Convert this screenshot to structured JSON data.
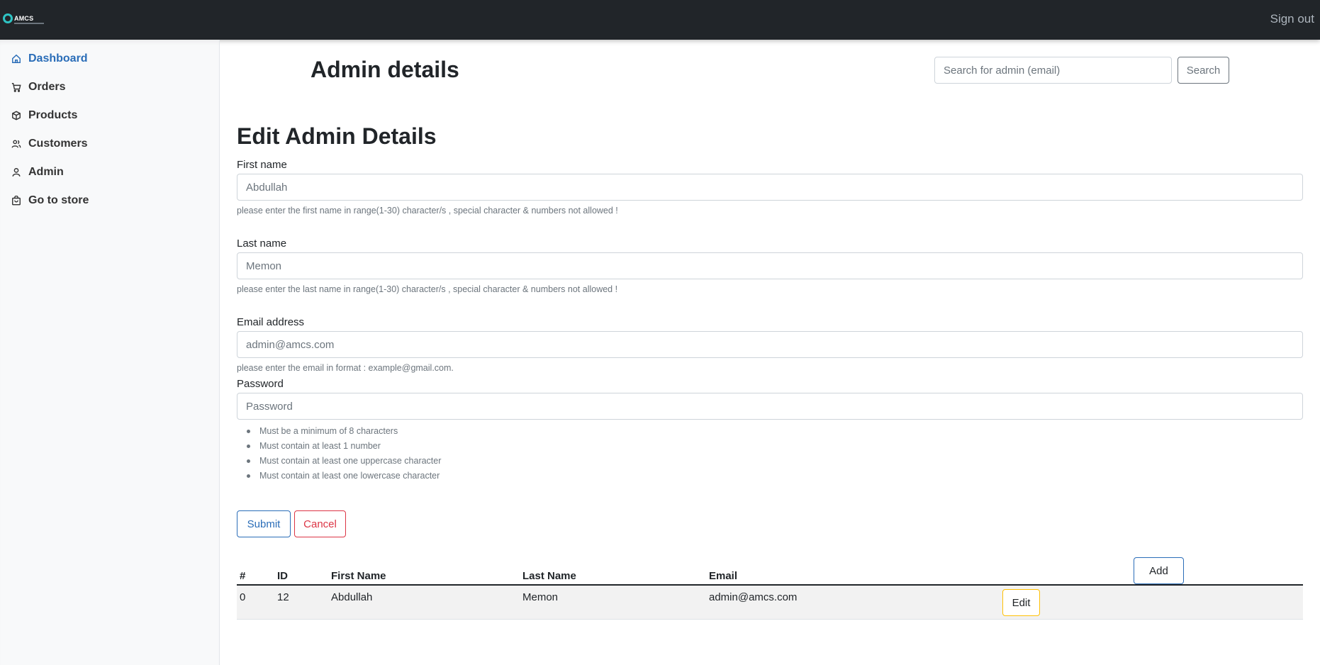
{
  "navbar": {
    "brand_text": "AMCS",
    "signout_label": "Sign out"
  },
  "sidebar": {
    "items": [
      {
        "label": "Dashboard",
        "icon": "home-icon",
        "active": true
      },
      {
        "label": "Orders",
        "icon": "cart-icon"
      },
      {
        "label": "Products",
        "icon": "box-icon"
      },
      {
        "label": "Customers",
        "icon": "users-icon"
      },
      {
        "label": "Admin",
        "icon": "user-icon"
      },
      {
        "label": "Go to store",
        "icon": "bag-icon"
      }
    ]
  },
  "header": {
    "title": "Admin details",
    "search_placeholder": "Search for admin (email)",
    "search_button": "Search"
  },
  "form": {
    "title": "Edit Admin Details",
    "first_name": {
      "label": "First name",
      "placeholder": "Abdullah",
      "help": "please enter the first name in range(1-30) character/s , special character & numbers not allowed !"
    },
    "last_name": {
      "label": "Last name",
      "placeholder": "Memon",
      "help": "please enter the last name in range(1-30) character/s , special character & numbers not allowed !"
    },
    "email": {
      "label": "Email address",
      "placeholder": "admin@amcs.com",
      "help": "please enter the email in format : example@gmail.com."
    },
    "password": {
      "label": "Password",
      "placeholder": "Password",
      "rules": [
        "Must be a minimum of 8 characters",
        "Must contain at least 1 number",
        "Must contain at least one uppercase character",
        "Must contain at least one lowercase character"
      ]
    },
    "submit_label": "Submit",
    "cancel_label": "Cancel"
  },
  "table": {
    "add_label": "Add",
    "columns": [
      "#",
      "ID",
      "First Name",
      "Last Name",
      "Email"
    ],
    "rows": [
      {
        "index": "0",
        "id": "12",
        "first_name": "Abdullah",
        "last_name": "Memon",
        "email": "admin@amcs.com",
        "action": "Edit"
      }
    ]
  },
  "colors": {
    "navbar_bg": "#212529",
    "sidebar_bg": "#f8f9fa",
    "primary": "#2a6db8",
    "danger": "#dc3545",
    "warning": "#ffc107"
  }
}
